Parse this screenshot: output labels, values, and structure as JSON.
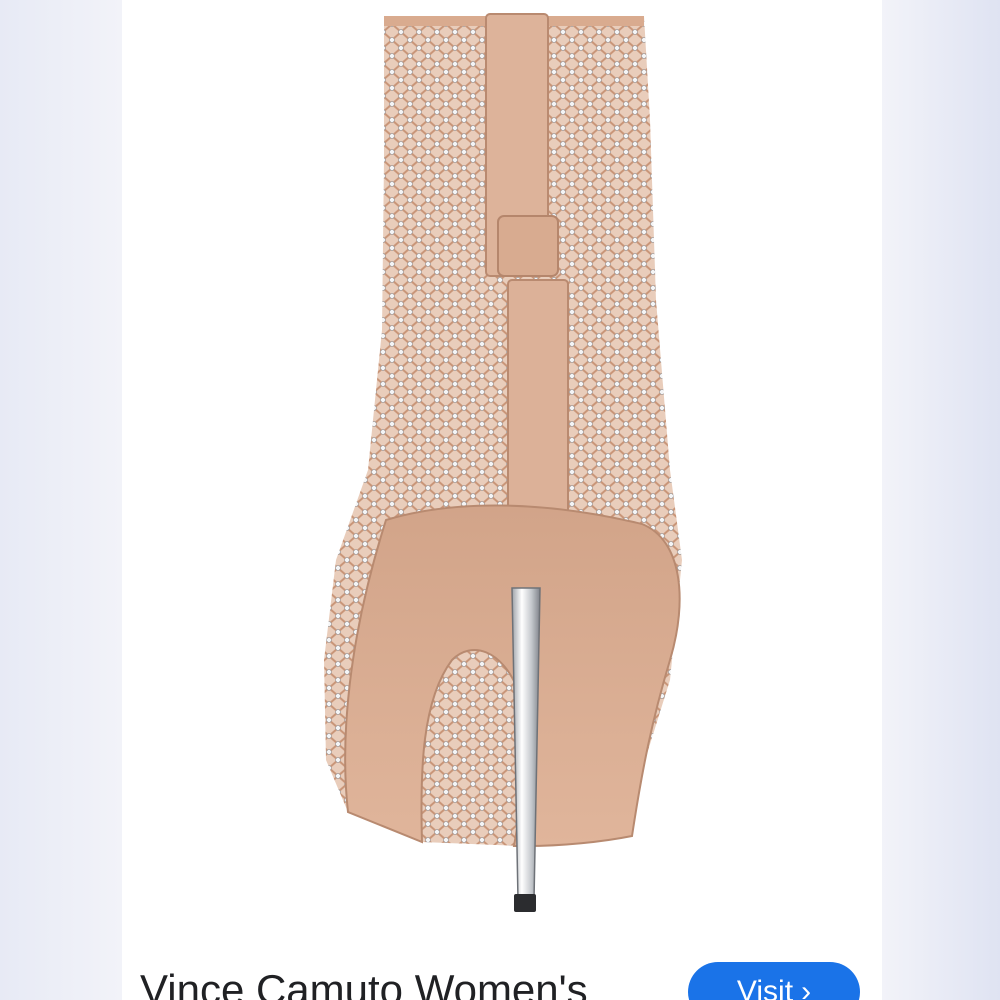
{
  "result": {
    "title": "Vince Camuto Women's",
    "visit_label": "Visit",
    "visit_chevron": "›"
  },
  "colors": {
    "accent": "#1a73e8",
    "title_text": "#202124",
    "shoe_nude": "#d8ad93",
    "heel_metal": "#c9ccd0"
  },
  "image": {
    "subject": "rhinestone-mesh-bootie-back-view"
  }
}
